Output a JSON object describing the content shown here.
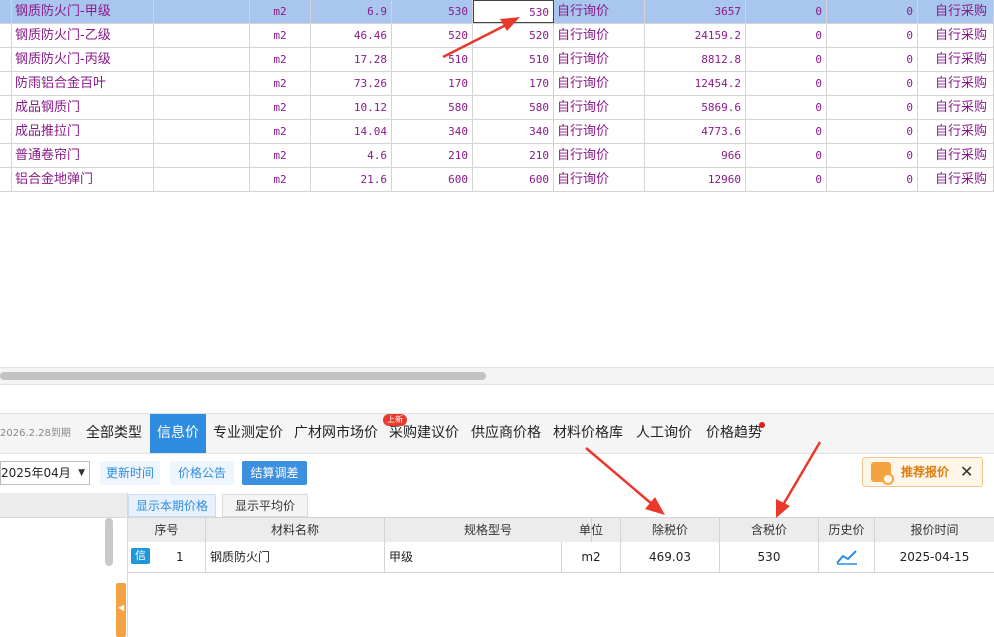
{
  "price_rows": [
    {
      "name": "钢质防火门-甲级",
      "unit": "m2",
      "quantity": "6.9",
      "price_a": "530",
      "price_b": "530",
      "source": "自行询价",
      "total": "3657",
      "z1": "0",
      "z2": "0",
      "method": "自行采购",
      "selected": true
    },
    {
      "name": "钢质防火门-乙级",
      "unit": "m2",
      "quantity": "46.46",
      "price_a": "520",
      "price_b": "520",
      "source": "自行询价",
      "total": "24159.2",
      "z1": "0",
      "z2": "0",
      "method": "自行采购",
      "selected": false
    },
    {
      "name": "钢质防火门-丙级",
      "unit": "m2",
      "quantity": "17.28",
      "price_a": "510",
      "price_b": "510",
      "source": "自行询价",
      "total": "8812.8",
      "z1": "0",
      "z2": "0",
      "method": "自行采购",
      "selected": false
    },
    {
      "name": "防雨铝合金百叶",
      "unit": "m2",
      "quantity": "73.26",
      "price_a": "170",
      "price_b": "170",
      "source": "自行询价",
      "total": "12454.2",
      "z1": "0",
      "z2": "0",
      "method": "自行采购",
      "selected": false
    },
    {
      "name": "成品钢质门",
      "unit": "m2",
      "quantity": "10.12",
      "price_a": "580",
      "price_b": "580",
      "source": "自行询价",
      "total": "5869.6",
      "z1": "0",
      "z2": "0",
      "method": "自行采购",
      "selected": false
    },
    {
      "name": "成品推拉门",
      "unit": "m2",
      "quantity": "14.04",
      "price_a": "340",
      "price_b": "340",
      "source": "自行询价",
      "total": "4773.6",
      "z1": "0",
      "z2": "0",
      "method": "自行采购",
      "selected": false
    },
    {
      "name": "普通卷帘门",
      "unit": "m2",
      "quantity": "4.6",
      "price_a": "210",
      "price_b": "210",
      "source": "自行询价",
      "total": "966",
      "z1": "0",
      "z2": "0",
      "method": "自行采购",
      "selected": false
    },
    {
      "name": "铝合金地弹门",
      "unit": "m2",
      "quantity": "21.6",
      "price_a": "600",
      "price_b": "600",
      "source": "自行询价",
      "total": "12960",
      "z1": "0",
      "z2": "0",
      "method": "自行采购",
      "selected": false
    }
  ],
  "tabbar": {
    "expiry": "2026.2.28到期",
    "tabs": [
      "全部类型",
      "信息价",
      "专业测定价",
      "广材网市场价",
      "采购建议价",
      "供应商价格",
      "材料价格库",
      "人工询价",
      "价格趋势"
    ],
    "new_badge": "上新"
  },
  "toolbar": {
    "month": "2025年04月",
    "update_time": "更新时间",
    "price_notice": "价格公告",
    "settle_adjust": "结算调差",
    "recommend": "推荐报价",
    "close": "✕"
  },
  "subtabs": {
    "current": "显示本期价格",
    "average": "显示平均价"
  },
  "info_table": {
    "headers": [
      "序号",
      "材料名称",
      "规格型号",
      "单位",
      "除税价",
      "含税价",
      "历史价",
      "报价时间"
    ],
    "row": {
      "tag": "信",
      "index": "1",
      "name": "钢质防火门",
      "spec": "甲级",
      "unit": "m2",
      "price_excl_tax": "469.03",
      "price_incl_tax": "530",
      "date": "2025-04-15"
    }
  },
  "colors": {
    "accent": "#2e8ce0",
    "row_text": "#8a1a8a",
    "selected_row": "#a9c6ee",
    "annotation": "#e8392c"
  }
}
